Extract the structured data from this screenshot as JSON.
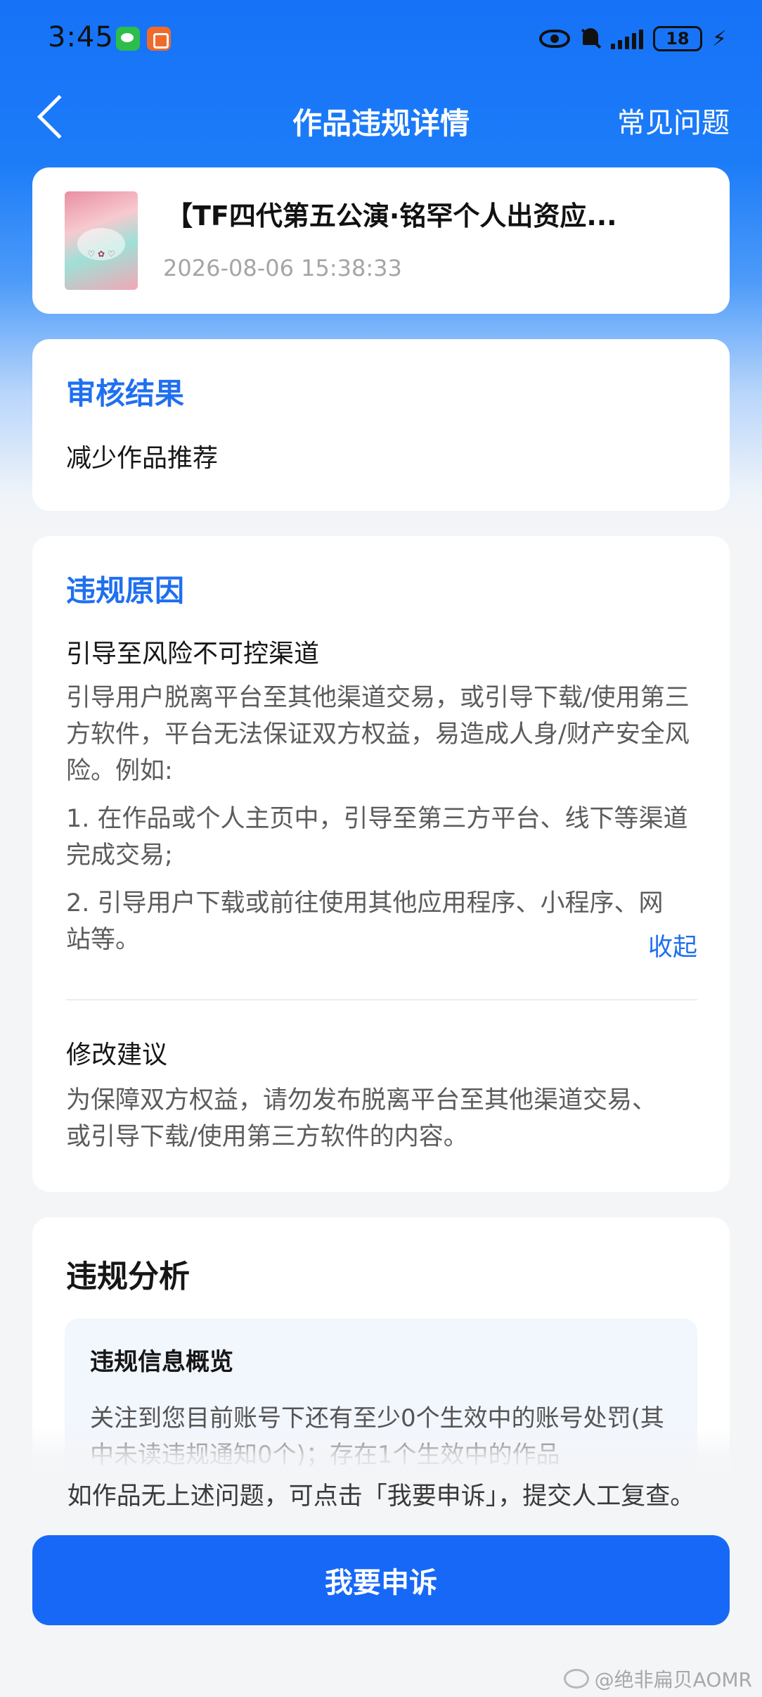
{
  "status_bar": {
    "time": "3:45",
    "battery": "18"
  },
  "header": {
    "title": "作品违规详情",
    "faq": "常见问题"
  },
  "work": {
    "title": "【TF四代第五公演·铭罕个人出资应...",
    "time": "2026-08-06 15:38:33"
  },
  "review_result": {
    "title": "审核结果",
    "value": "减少作品推荐"
  },
  "violation_reason": {
    "title": "违规原因",
    "name": "引导至风险不可控渠道",
    "description": "引导用户脱离平台至其他渠道交易，或引导下载/使用第三方软件，平台无法保证双方权益，易造成人身/财产安全风险。例如:",
    "example_1": "1. 在作品或个人主页中，引导至第三方平台、线下等渠道完成交易;",
    "example_2": "2. 引导用户下载或前往使用其他应用程序、小程序、网站等。",
    "collapse": "收起",
    "suggestion_title": "修改建议",
    "suggestion": "为保障双方权益，请勿发布脱离平台至其他渠道交易、或引导下载/使用第三方软件的内容。"
  },
  "analysis": {
    "title": "违规分析",
    "overview_title": "违规信息概览",
    "overview_text": "关注到您目前账号下还有至少0个生效中的账号处罚(其中未读违规通知0个)；存在1个生效中的作品"
  },
  "footer": {
    "hint": "如作品无上述问题，可点击「我要申诉」，提交人工复查。",
    "appeal_button": "我要申诉",
    "watermark": "@绝非扁贝AOMR"
  }
}
